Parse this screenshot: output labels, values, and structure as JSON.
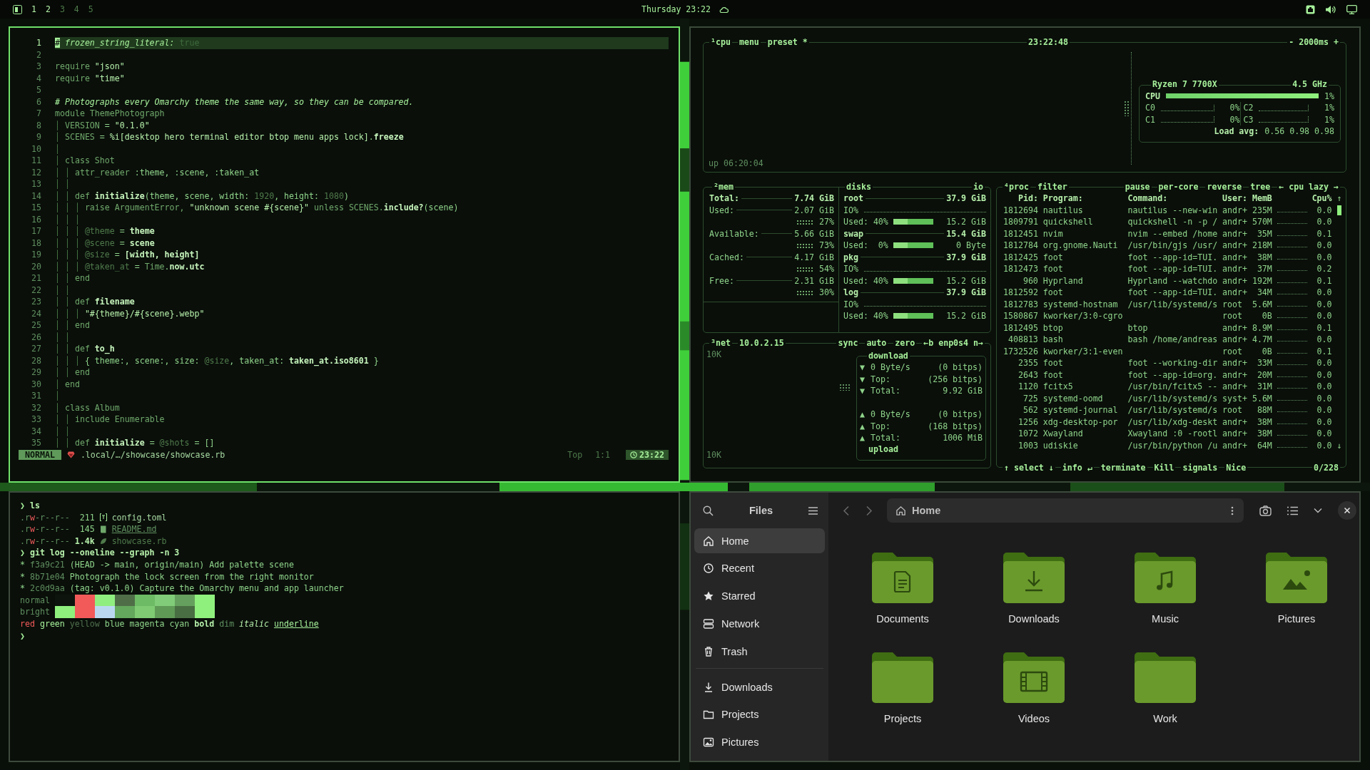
{
  "top_bar": {
    "workspaces": [
      {
        "label": "1",
        "occupied": true
      },
      {
        "label": "2",
        "occupied": true
      },
      {
        "label": "3",
        "occupied": false
      },
      {
        "label": "4",
        "occupied": false
      },
      {
        "label": "5",
        "occupied": false
      }
    ],
    "clock": "Thursday 23:22"
  },
  "editor": {
    "lines": [
      {
        "number": "1",
        "current": true,
        "segments": [
          {
            "kind": "cursor",
            "text": "#"
          },
          {
            "kind": "comment",
            "text": " frozen_string_literal:"
          },
          {
            "kind": "dim",
            "text": " true"
          }
        ]
      },
      {
        "number": "2",
        "current": false
      },
      {
        "number": "3",
        "current": false,
        "segments": [
          {
            "kind": "keyword",
            "text": "require "
          },
          {
            "kind": "string",
            "text": "\"json\""
          }
        ]
      },
      {
        "number": "4",
        "current": false,
        "segments": [
          {
            "kind": "keyword",
            "text": "require "
          },
          {
            "kind": "string",
            "text": "\"time\""
          }
        ]
      },
      {
        "number": "5",
        "current": false
      },
      {
        "number": "6",
        "current": false,
        "segments": [
          {
            "kind": "comment",
            "text": "# Photographs every Omarchy theme the same way, so they can be compared."
          }
        ]
      },
      {
        "number": "7",
        "current": false,
        "segments": [
          {
            "kind": "keyword",
            "text": "module ThemePhotograph"
          }
        ]
      },
      {
        "number": "8",
        "current": false,
        "segments": [
          {
            "kind": "guide",
            "text": "│ "
          },
          {
            "kind": "const",
            "text": "VERSION"
          },
          {
            "kind": "plain",
            "text": " = "
          },
          {
            "kind": "string",
            "text": "\"0.1.0\""
          }
        ]
      },
      {
        "number": "9",
        "current": false,
        "segments": [
          {
            "kind": "guide",
            "text": "│ "
          },
          {
            "kind": "const",
            "text": "SCENES"
          },
          {
            "kind": "plain",
            "text": " = "
          },
          {
            "kind": "string",
            "text": "%i[desktop hero terminal editor btop menu apps lock]"
          },
          {
            "kind": "plain",
            "text": "."
          },
          {
            "kind": "ident",
            "text": "freeze"
          }
        ]
      },
      {
        "number": "10",
        "current": false,
        "segments": [
          {
            "kind": "guide",
            "text": "│"
          }
        ]
      },
      {
        "number": "11",
        "current": false,
        "segments": [
          {
            "kind": "guide",
            "text": "│ "
          },
          {
            "kind": "keyword",
            "text": "class Shot"
          }
        ]
      },
      {
        "number": "12",
        "current": false,
        "segments": [
          {
            "kind": "guide",
            "text": "│ │ "
          },
          {
            "kind": "keyword",
            "text": "attr_reader"
          },
          {
            "kind": "plain",
            "text": " :theme, :scene, :taken_at"
          }
        ]
      },
      {
        "number": "13",
        "current": false,
        "segments": [
          {
            "kind": "guide",
            "text": "│ │"
          }
        ]
      },
      {
        "number": "14",
        "current": false,
        "segments": [
          {
            "kind": "guide",
            "text": "│ │ "
          },
          {
            "kind": "keyword",
            "text": "def "
          },
          {
            "kind": "ident",
            "text": "initialize"
          },
          {
            "kind": "plain",
            "text": "(theme, scene, width: "
          },
          {
            "kind": "number",
            "text": "1920"
          },
          {
            "kind": "plain",
            "text": ", height: "
          },
          {
            "kind": "number",
            "text": "1080"
          },
          {
            "kind": "plain",
            "text": ")"
          }
        ]
      },
      {
        "number": "15",
        "current": false,
        "segments": [
          {
            "kind": "guide",
            "text": "│ │ │ "
          },
          {
            "kind": "keyword",
            "text": "raise "
          },
          {
            "kind": "const",
            "text": "ArgumentError,"
          },
          {
            "kind": "string",
            "text": " \"unknown scene #{scene}\""
          },
          {
            "kind": "keyword",
            "text": " unless "
          },
          {
            "kind": "const",
            "text": "SCENES."
          },
          {
            "kind": "ident",
            "text": "include?"
          },
          {
            "kind": "plain",
            "text": "(scene)"
          }
        ]
      },
      {
        "number": "16",
        "current": false,
        "segments": [
          {
            "kind": "guide",
            "text": "│ │ │"
          }
        ]
      },
      {
        "number": "17",
        "current": false,
        "segments": [
          {
            "kind": "guide",
            "text": "│ │ │ "
          },
          {
            "kind": "ivar",
            "text": "@theme"
          },
          {
            "kind": "plain",
            "text": " = "
          },
          {
            "kind": "ident",
            "text": "theme"
          }
        ]
      },
      {
        "number": "18",
        "current": false,
        "segments": [
          {
            "kind": "guide",
            "text": "│ │ │ "
          },
          {
            "kind": "ivar",
            "text": "@scene"
          },
          {
            "kind": "plain",
            "text": " = "
          },
          {
            "kind": "ident",
            "text": "scene"
          }
        ]
      },
      {
        "number": "19",
        "current": false,
        "segments": [
          {
            "kind": "guide",
            "text": "│ │ │ "
          },
          {
            "kind": "ivar",
            "text": "@size"
          },
          {
            "kind": "plain",
            "text": " = "
          },
          {
            "kind": "ident",
            "text": "[width, height]"
          }
        ]
      },
      {
        "number": "20",
        "current": false,
        "segments": [
          {
            "kind": "guide",
            "text": "│ │ │ "
          },
          {
            "kind": "ivar",
            "text": "@taken_at"
          },
          {
            "kind": "plain",
            "text": " = "
          },
          {
            "kind": "const",
            "text": "Time"
          },
          {
            "kind": "plain",
            "text": "."
          },
          {
            "kind": "ident",
            "text": "now.utc"
          }
        ]
      },
      {
        "number": "21",
        "current": false,
        "segments": [
          {
            "kind": "guide",
            "text": "│ │ "
          },
          {
            "kind": "keyword",
            "text": "end"
          }
        ]
      },
      {
        "number": "22",
        "current": false,
        "segments": [
          {
            "kind": "guide",
            "text": "│ │"
          }
        ]
      },
      {
        "number": "23",
        "current": false,
        "segments": [
          {
            "kind": "guide",
            "text": "│ │ "
          },
          {
            "kind": "keyword",
            "text": "def "
          },
          {
            "kind": "ident",
            "text": "filename"
          }
        ]
      },
      {
        "number": "24",
        "current": false,
        "segments": [
          {
            "kind": "guide",
            "text": "│ │ │ "
          },
          {
            "kind": "string",
            "text": "\"#{theme}/#{scene}.webp\""
          }
        ]
      },
      {
        "number": "25",
        "current": false,
        "segments": [
          {
            "kind": "guide",
            "text": "│ │ "
          },
          {
            "kind": "keyword",
            "text": "end"
          }
        ]
      },
      {
        "number": "26",
        "current": false,
        "segments": [
          {
            "kind": "guide",
            "text": "│ │"
          }
        ]
      },
      {
        "number": "27",
        "current": false,
        "segments": [
          {
            "kind": "guide",
            "text": "│ │ "
          },
          {
            "kind": "keyword",
            "text": "def "
          },
          {
            "kind": "ident",
            "text": "to_h"
          }
        ]
      },
      {
        "number": "28",
        "current": false,
        "segments": [
          {
            "kind": "guide",
            "text": "│ │ │ "
          },
          {
            "kind": "plain",
            "text": "{ theme:, scene:, size: "
          },
          {
            "kind": "ivar",
            "text": "@size"
          },
          {
            "kind": "plain",
            "text": ", taken_at: "
          },
          {
            "kind": "ident",
            "text": "taken_at.iso8601"
          },
          {
            "kind": "plain",
            "text": " }"
          }
        ]
      },
      {
        "number": "29",
        "current": false,
        "segments": [
          {
            "kind": "guide",
            "text": "│ │ "
          },
          {
            "kind": "keyword",
            "text": "end"
          }
        ]
      },
      {
        "number": "30",
        "current": false,
        "segments": [
          {
            "kind": "guide",
            "text": "│ "
          },
          {
            "kind": "keyword",
            "text": "end"
          }
        ]
      },
      {
        "number": "31",
        "current": false,
        "segments": [
          {
            "kind": "guide",
            "text": "│"
          }
        ]
      },
      {
        "number": "32",
        "current": false,
        "segments": [
          {
            "kind": "guide",
            "text": "│ "
          },
          {
            "kind": "keyword",
            "text": "class Album"
          }
        ]
      },
      {
        "number": "33",
        "current": false,
        "segments": [
          {
            "kind": "guide",
            "text": "│ │ "
          },
          {
            "kind": "keyword",
            "text": "include "
          },
          {
            "kind": "const",
            "text": "Enumerable"
          }
        ]
      },
      {
        "number": "34",
        "current": false,
        "segments": [
          {
            "kind": "guide",
            "text": "│ │"
          }
        ]
      },
      {
        "number": "35",
        "current": false,
        "segments": [
          {
            "kind": "guide",
            "text": "│ │ "
          },
          {
            "kind": "keyword",
            "text": "def "
          },
          {
            "kind": "ident",
            "text": "initialize"
          },
          {
            "kind": "plain",
            "text": " = "
          },
          {
            "kind": "ivar",
            "text": "@shots"
          },
          {
            "kind": "plain",
            "text": " = []"
          }
        ]
      }
    ],
    "status": {
      "mode": "NORMAL",
      "path": ".local/…/showcase/showcase.rb",
      "position": "Top",
      "cursor": "1:1",
      "time": "23:22"
    }
  },
  "btop": {
    "cpu": {
      "tabs": [
        "¹cpu",
        "menu",
        "preset *"
      ],
      "clock": "23:22:48",
      "interval": "- 2000ms +",
      "uptime": "up 06:20:04",
      "model": "Ryzen 7 7700X",
      "frequency": "4.5 GHz",
      "total": {
        "label": "CPU",
        "percent": "1%"
      },
      "cores": [
        {
          "label": "C0",
          "percent": "0%"
        },
        {
          "label": "C2",
          "percent": "1%"
        },
        {
          "label": "C1",
          "percent": "0%"
        },
        {
          "label": "C3",
          "percent": "1%"
        }
      ],
      "load_label": "Load avg:",
      "load": "0.56 0.98 0.98"
    },
    "mem": {
      "title": "²mem",
      "rows": [
        {
          "label": "Total:",
          "value": "7.74 GiB"
        },
        {
          "label": "Used:",
          "value": "2.07 GiB",
          "percent": "27%"
        },
        {
          "label": "Available:",
          "value": "5.66 GiB",
          "percent": "73%"
        },
        {
          "label": "Cached:",
          "value": "4.17 GiB",
          "percent": "54%"
        },
        {
          "label": "Free:",
          "value": "2.31 GiB",
          "percent": "30%"
        }
      ]
    },
    "disks": {
      "title": "disks",
      "io_toggle": "io",
      "items": [
        {
          "name": "root",
          "size": "37.9 GiB",
          "io_label": "IO%",
          "used_label": "Used:",
          "used": "40%",
          "used_size": "15.2 GiB"
        },
        {
          "name": "swap",
          "size": "15.4 GiB",
          "used_label": "Used:",
          "used": "0%",
          "used_size": "0 Byte"
        },
        {
          "name": "pkg",
          "size": "37.9 GiB",
          "io_label": "IO%",
          "used_label": "Used:",
          "used": "40%",
          "used_size": "15.2 GiB"
        },
        {
          "name": "log",
          "size": "37.9 GiB",
          "io_label": "IO%",
          "used_label": "Used:",
          "used": "40%",
          "used_size": "15.2 GiB"
        }
      ]
    },
    "net": {
      "title": "³net",
      "address": "10.0.2.15",
      "options": [
        "sync",
        "auto",
        "zero",
        "←b enp0s4 n→"
      ],
      "scale_top": "10K",
      "scale_bottom": "10K",
      "download_title": "download",
      "upload_title": "upload",
      "rows": [
        {
          "arrow": "▼",
          "label": "0 Byte/s",
          "value": "(0 bitps)"
        },
        {
          "arrow": "▼",
          "label": "Top:",
          "value": "(256 bitps)"
        },
        {
          "arrow": "▼",
          "label": "Total:",
          "value": "9.92 GiB"
        },
        {
          "arrow": "▲",
          "label": "0 Byte/s",
          "value": "(0 bitps)"
        },
        {
          "arrow": "▲",
          "label": "Top:",
          "value": "(168 bitps)"
        },
        {
          "arrow": "▲",
          "label": "Total:",
          "value": "1006 MiB"
        }
      ]
    },
    "proc": {
      "title": "⁴proc",
      "filter": "filter",
      "options": [
        "pause",
        "per-core",
        "reverse",
        "tree",
        "← cpu lazy →"
      ],
      "columns": [
        "Pid:",
        "Program:",
        "Command:",
        "User:",
        "MemB",
        "Cpu%"
      ],
      "scroll_up": "↑",
      "scroll_down": "↓",
      "rows": [
        {
          "pid": "1812694",
          "program": "nautilus",
          "command": "nautilus --new-win",
          "user": "andr+",
          "memory": "235M",
          "cpu": "0.0"
        },
        {
          "pid": "1809791",
          "program": "quickshell",
          "command": "quickshell -n -p /",
          "user": "andr+",
          "memory": "570M",
          "cpu": "0.0"
        },
        {
          "pid": "1812451",
          "program": "nvim",
          "command": "nvim --embed /home",
          "user": "andr+",
          "memory": "35M",
          "cpu": "0.1"
        },
        {
          "pid": "1812784",
          "program": "org.gnome.Nauti",
          "command": "/usr/bin/gjs /usr/",
          "user": "andr+",
          "memory": "218M",
          "cpu": "0.0"
        },
        {
          "pid": "1812425",
          "program": "foot",
          "command": "foot --app-id=TUI.",
          "user": "andr+",
          "memory": "38M",
          "cpu": "0.0"
        },
        {
          "pid": "1812473",
          "program": "foot",
          "command": "foot --app-id=TUI.",
          "user": "andr+",
          "memory": "37M",
          "cpu": "0.2"
        },
        {
          "pid": "960",
          "program": "Hyprland",
          "command": "Hyprland --watchdo",
          "user": "andr+",
          "memory": "192M",
          "cpu": "0.1"
        },
        {
          "pid": "1812592",
          "program": "foot",
          "command": "foot --app-id=TUI.",
          "user": "andr+",
          "memory": "34M",
          "cpu": "0.0"
        },
        {
          "pid": "1812783",
          "program": "systemd-hostnam",
          "command": "/usr/lib/systemd/s",
          "user": "root",
          "memory": "5.6M",
          "cpu": "0.0"
        },
        {
          "pid": "1580867",
          "program": "kworker/3:0-cgro",
          "user": "root",
          "memory": "0B",
          "cpu": "0.0"
        },
        {
          "pid": "1812495",
          "program": "btop",
          "command": "btop",
          "user": "andr+",
          "memory": "8.9M",
          "cpu": "0.1"
        },
        {
          "pid": "408813",
          "program": "bash",
          "command": "bash /home/andreas",
          "user": "andr+",
          "memory": "4.7M",
          "cpu": "0.0"
        },
        {
          "pid": "1732526",
          "program": "kworker/3:1-even",
          "user": "root",
          "memory": "0B",
          "cpu": "0.1"
        },
        {
          "pid": "2355",
          "program": "foot",
          "command": "foot --working-dir",
          "user": "andr+",
          "memory": "33M",
          "cpu": "0.0"
        },
        {
          "pid": "2643",
          "program": "foot",
          "command": "foot --app-id=org.",
          "user": "andr+",
          "memory": "20M",
          "cpu": "0.0"
        },
        {
          "pid": "1120",
          "program": "fcitx5",
          "command": "/usr/bin/fcitx5 --",
          "user": "andr+",
          "memory": "31M",
          "cpu": "0.0"
        },
        {
          "pid": "725",
          "program": "systemd-oomd",
          "command": "/usr/lib/systemd/s",
          "user": "syst+",
          "memory": "5.6M",
          "cpu": "0.0"
        },
        {
          "pid": "562",
          "program": "systemd-journal",
          "command": "/usr/lib/systemd/s",
          "user": "root",
          "memory": "88M",
          "cpu": "0.0"
        },
        {
          "pid": "1256",
          "program": "xdg-desktop-por",
          "command": "/usr/lib/xdg-deskt",
          "user": "andr+",
          "memory": "38M",
          "cpu": "0.0"
        },
        {
          "pid": "1072",
          "program": "Xwayland",
          "command": "Xwayland :0 -rootl",
          "user": "andr+",
          "memory": "38M",
          "cpu": "0.0"
        },
        {
          "pid": "1003",
          "program": "udiskie",
          "command": "/usr/bin/python /u",
          "user": "andr+",
          "memory": "64M",
          "cpu": "0.0"
        }
      ],
      "footer": [
        "↑ select ↓",
        "info ↵",
        "terminate",
        "Kill",
        "signals",
        "Nice"
      ],
      "count": "0/228"
    }
  },
  "terminal": {
    "lines": [
      {
        "kind": "prompt",
        "symbol": "❯",
        "command": "ls"
      },
      {
        "kind": "toml_file",
        "permissions": [
          {
            "kind": "dim",
            "text": ".r"
          },
          {
            "kind": "write",
            "text": "w"
          },
          {
            "kind": "dim",
            "text": "-r--r--"
          }
        ],
        "size": "211",
        "name": "config.toml"
      },
      {
        "kind": "markdown_file",
        "permissions": [
          {
            "kind": "dim",
            "text": ".r"
          },
          {
            "kind": "write",
            "text": "w"
          },
          {
            "kind": "dim",
            "text": "-r--r--"
          }
        ],
        "size": "145",
        "name": "README.md"
      },
      {
        "kind": "ruby_file",
        "permissions": [
          {
            "kind": "dim",
            "text": ".r"
          },
          {
            "kind": "write",
            "text": "w"
          },
          {
            "kind": "dim",
            "text": "-r--r--"
          }
        ],
        "size": "1.4k",
        "name": "showcase.rb"
      },
      {
        "kind": "prompt",
        "symbol": "❯",
        "command": "git log --oneline --graph -n 3"
      },
      {
        "kind": "commit",
        "graph": "*",
        "hash": "f3a9c21",
        "refs": "(HEAD -> main, origin/main)",
        "message": "Add palette scene"
      },
      {
        "kind": "commit",
        "graph": "*",
        "hash": "8b71e04",
        "message": "Photograph the lock screen from the right monitor"
      },
      {
        "kind": "commit",
        "graph": "*",
        "hash": "2c0d9aa",
        "refs": "(tag: v0.1.0)",
        "message": "Capture the Omarchy menu and app launcher"
      },
      {
        "kind": "palette",
        "label": "normal",
        "swatches": [
          {
            "color": "#0d140d"
          },
          {
            "color": "#f25a5a"
          },
          {
            "color": "#90ee80"
          },
          {
            "color": "#4f6e48"
          },
          {
            "color": "#6dbb64"
          },
          {
            "color": "#80cc78"
          },
          {
            "color": "#66a05e"
          },
          {
            "color": "#8ff07d"
          }
        ]
      },
      {
        "kind": "palette",
        "label": "bright",
        "swatches": [
          {
            "color": "#8ff07d"
          },
          {
            "color": "#f25a5a"
          },
          {
            "color": "#b9d8f0"
          },
          {
            "color": "#63a85c"
          },
          {
            "color": "#7ecb73"
          },
          {
            "color": "#5f9a57"
          },
          {
            "color": "#4a6e43"
          },
          {
            "color": "#8ff07d"
          }
        ]
      },
      {
        "kind": "styles",
        "words": [
          {
            "kind": "red",
            "text": "red"
          },
          {
            "kind": "green",
            "text": "green"
          },
          {
            "kind": "yellow",
            "text": "yellow"
          },
          {
            "kind": "blue",
            "text": "blue"
          },
          {
            "kind": "magenta",
            "text": "magenta"
          },
          {
            "kind": "cyan",
            "text": "cyan"
          },
          {
            "kind": "bold",
            "text": "bold"
          },
          {
            "kind": "dim",
            "text": "dim"
          },
          {
            "kind": "italic",
            "text": "italic"
          },
          {
            "kind": "underline",
            "text": "underline"
          }
        ]
      },
      {
        "kind": "prompt",
        "symbol": "❯"
      }
    ]
  },
  "files": {
    "title": "Files",
    "location": "Home",
    "places": [
      {
        "label": "Home",
        "kind": "home",
        "selected": true
      },
      {
        "label": "Recent",
        "kind": "recent",
        "selected": false
      },
      {
        "label": "Starred",
        "kind": "starred",
        "selected": false
      },
      {
        "label": "Network",
        "kind": "network",
        "selected": false
      },
      {
        "label": "Trash",
        "kind": "trash",
        "selected": false
      }
    ],
    "bookmarks": [
      {
        "label": "Downloads",
        "kind": "downloads",
        "selected": false
      },
      {
        "label": "Projects",
        "kind": "folder",
        "selected": false
      },
      {
        "label": "Pictures",
        "kind": "pictures",
        "selected": false
      }
    ],
    "folders": [
      {
        "name": "Documents",
        "kind": "documents"
      },
      {
        "name": "Downloads",
        "kind": "downloads"
      },
      {
        "name": "Music",
        "kind": "music"
      },
      {
        "name": "Pictures",
        "kind": "pictures"
      },
      {
        "name": "Projects",
        "kind": "plain"
      },
      {
        "name": "Videos",
        "kind": "videos"
      },
      {
        "name": "Work",
        "kind": "plain"
      }
    ]
  }
}
